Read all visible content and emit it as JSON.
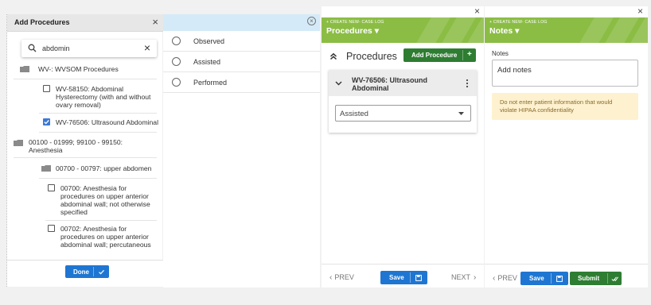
{
  "panel1": {
    "title": "Add Procedures",
    "close": "×",
    "search_value": "abdomin",
    "clear": "×",
    "tree": {
      "group1": "WV-: WVSOM Procedures",
      "item1": [
        "WV-58150: Abdominal",
        "Hysterectomy (with and without",
        "ovary removal)"
      ],
      "item2": "WV-76506: Ultrasound Abdominal",
      "group2": [
        "00100 - 01999; 99100 - 99150:",
        "Anesthesia"
      ],
      "group3": "00700 - 00797: upper abdomen",
      "item3": [
        "00700: Anesthesia for",
        "procedures on upper anterior",
        "abdominal wall; not otherwise",
        "specified"
      ],
      "item4": [
        "00702: Anesthesia for",
        "procedures on upper anterior",
        "abdominal wall; percutaneous"
      ]
    },
    "done_label": "Done"
  },
  "panel2": {
    "options": [
      "Observed",
      "Assisted",
      "Performed"
    ]
  },
  "panel3": {
    "caption": "+ CREATE NEW- CASE LOG",
    "title": "Procedures ▾",
    "section_title": "Procedures",
    "add_label": "Add Procedure",
    "add_plus": "+",
    "card_title": [
      "WV-76506: Ultrasound",
      "Abdominal"
    ],
    "select_value": "Assisted",
    "prev_label": "PREV",
    "next_label": "NEXT",
    "save_label": "Save"
  },
  "panel4": {
    "caption": "+ CREATE NEW- CASE LOG",
    "title": "Notes ▾",
    "notes_label": "Notes",
    "notes_placeholder": "Add notes",
    "warning": [
      "Do not enter patient information that would",
      "violate HIPAA confidentiality"
    ],
    "prev_label": "PREV",
    "save_label": "Save",
    "submit_label": "Submit"
  },
  "colors": {
    "green_header": "#8bbd45",
    "primary_blue": "#1f76d2",
    "submit_green": "#2e7d32",
    "warning_bg": "#fdf1cf",
    "radio_header": "#d4eaf8"
  }
}
